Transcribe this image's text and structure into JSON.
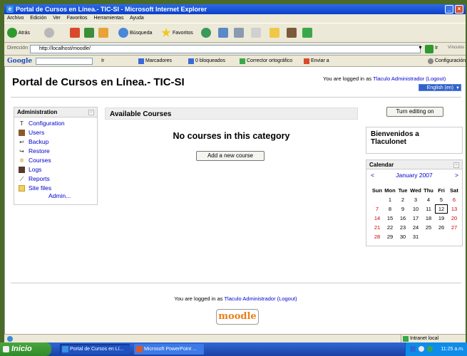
{
  "window": {
    "title": "Portal de Cursos en Línea.- TIC-SI - Microsoft Internet Explorer"
  },
  "menu": [
    "Archivo",
    "Edición",
    "Ver",
    "Favoritos",
    "Herramientas",
    "Ayuda"
  ],
  "toolbar": {
    "back_label": "Atrás",
    "search_label": "Búsqueda",
    "favorites_label": "Favoritos"
  },
  "address": {
    "label": "Dirección",
    "url": "http://localhost/moodle/",
    "go_label": "Ir",
    "links_label": "Vínculos"
  },
  "googlebar": {
    "logo": "Google",
    "go": "Ir",
    "bookmarks": "Marcadores",
    "blocked": "0 bloqueados",
    "spellcheck": "Corrector ortográfico",
    "send": "Enviar a",
    "settings": "Configuración"
  },
  "page": {
    "title": "Portal de Cursos en Línea.- TIC-SI",
    "logged_prefix": "You are logged in as",
    "user": "Tlaculo Administrador",
    "logout": "(Logout)",
    "language": "English (en)"
  },
  "admin": {
    "heading": "Administration",
    "items": [
      "Configuration",
      "Users",
      "Backup",
      "Restore",
      "Courses",
      "Logs",
      "Reports",
      "Site files"
    ],
    "more": "Admin..."
  },
  "courses": {
    "heading": "Available Courses",
    "empty_message": "No courses in this category",
    "add_button": "Add a new course"
  },
  "editing_button": "Turn editing on",
  "welcome": "Bienvenidos a Tlaculonet",
  "calendar": {
    "heading": "Calendar",
    "prev": "<",
    "next": ">",
    "month": "January 2007",
    "days_of_week": [
      "Sun",
      "Mon",
      "Tue",
      "Wed",
      "Thu",
      "Fri",
      "Sat"
    ],
    "weeks": [
      [
        "",
        "1",
        "2",
        "3",
        "4",
        "5",
        "6"
      ],
      [
        "7",
        "8",
        "9",
        "10",
        "11",
        "12",
        "13"
      ],
      [
        "14",
        "15",
        "16",
        "17",
        "18",
        "19",
        "20"
      ],
      [
        "21",
        "22",
        "23",
        "24",
        "25",
        "26",
        "27"
      ],
      [
        "28",
        "29",
        "30",
        "31",
        "",
        "",
        ""
      ]
    ],
    "today": "12"
  },
  "footer": {
    "logged_prefix": "You are logged in as",
    "user": "Tlaculo Administrador",
    "logout": "(Logout)",
    "logo_text": "moodle"
  },
  "statusbar": {
    "zone": "Intranet local"
  },
  "taskbar": {
    "start": "Inicio",
    "tasks": [
      "Portal de Cursos en Lí...",
      "Microsoft PowerPoint ..."
    ],
    "clock": "11:25 a.m."
  }
}
